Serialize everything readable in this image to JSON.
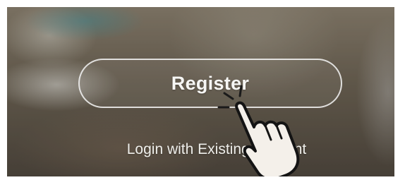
{
  "onboarding": {
    "register_label": "Register",
    "login_label": "Login with Existing Account",
    "gesture_icon": "tap-hand-icon"
  }
}
